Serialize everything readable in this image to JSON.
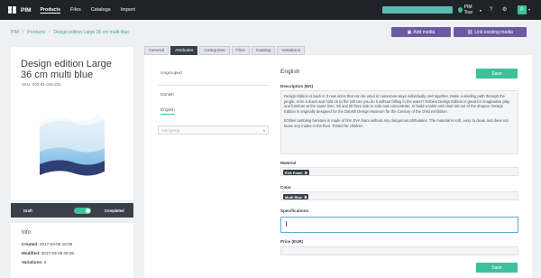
{
  "topbar": {
    "app_name": "PIM",
    "nav": [
      "Products",
      "Files",
      "Catalogs",
      "Import"
    ],
    "tour_label": "PIM Tour",
    "user_initial": "P",
    "icons": [
      "help-icon",
      "gear-icon"
    ]
  },
  "breadcrumb": [
    "PIM",
    "Products",
    "Design edition Large 36 cm multi blue"
  ],
  "actions": {
    "add_media": "Add media",
    "link_media": "Link existing media"
  },
  "product": {
    "title": "Design edition Large 36 cm multi blue",
    "sku": "SKU: 003-91-036-222"
  },
  "status": {
    "draft": "Draft",
    "completed": "Completed",
    "completed_on": true
  },
  "info": {
    "title": "Info",
    "created_label": "Created:",
    "created_value": "2017-03-08 16:06",
    "modified_label": "Modified:",
    "modified_value": "2017-03-09 09:36",
    "variations_label": "Variations:",
    "variations_value": "0"
  },
  "tabs": [
    "General",
    "Attributes",
    "Categories",
    "Files",
    "Catalog",
    "Variations"
  ],
  "active_tab": "Attributes",
  "groups": {
    "ungrouped": "Ungrouped",
    "items": [
      "Danish",
      "English"
    ],
    "selected": "English",
    "add_placeholder": "Add group"
  },
  "language_title": "English",
  "save_label": "Save",
  "fields": {
    "description_label": "Description (EN)",
    "description_p1": "Design Edition is back in 3 new sizes that can be used in numerous ways individually and together. Make a winding path through the jungle, or lie it down and hold on to the raft can you do it without falling in the water? bObles Design Edition is great for imaginative play and furniture at the same time. Sit and tilt from side to side and concentrate, or build a table and chair set out of the shapes. Design Edition is originally designed for the Danish Design Museum for the Century of the child exhibition.",
    "description_p2": "bObles tumbling furniture is made of firm EVA foam without any dangerous phthalates. The material is soft, easy to clean and does not leave any marks in the floor. Tested for children.",
    "material_label": "Material",
    "material_tag": "EVA Foam",
    "color_label": "Color",
    "color_tag": "Multi Blue",
    "spec_label": "Specifications",
    "spec_value": "",
    "price_label": "Price (EUR)",
    "price_value": ""
  },
  "colors": {
    "accent": "#3fbf9c",
    "purple": "#6a5aa3",
    "dark": "#1f2328",
    "link": "#3fa69a"
  }
}
